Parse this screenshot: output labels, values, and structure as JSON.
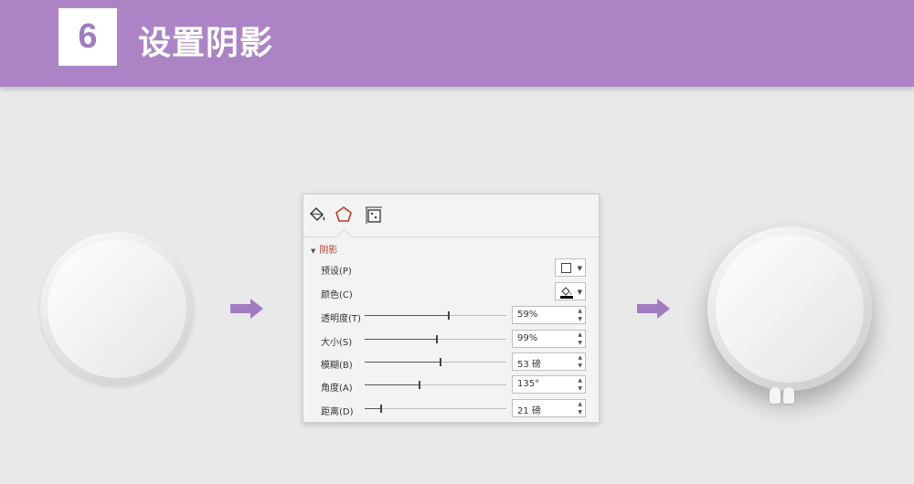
{
  "banner": {
    "step_number": "6",
    "title": "设置阴影",
    "color": "#ac84c6"
  },
  "arrow_color": "#a07cc0",
  "panel": {
    "tabs": [
      {
        "icon": "fill-bucket-icon"
      },
      {
        "icon": "pentagon-effects-icon",
        "active": true
      },
      {
        "icon": "size-layout-icon"
      }
    ],
    "section_title": "阴影",
    "preset_label": "预设(P)",
    "color_label": "颜色(C)",
    "sliders": [
      {
        "label": "透明度(T)",
        "value": "59%",
        "position": 0.59
      },
      {
        "label": "大小(S)",
        "value": "99%",
        "position": 0.5
      },
      {
        "label": "模糊(B)",
        "value": "53 磅",
        "position": 0.53
      },
      {
        "label": "角度(A)",
        "value": "135°",
        "position": 0.38
      },
      {
        "label": "距离(D)",
        "value": "21 磅",
        "position": 0.11
      }
    ],
    "accent_color": "#c0392b"
  }
}
